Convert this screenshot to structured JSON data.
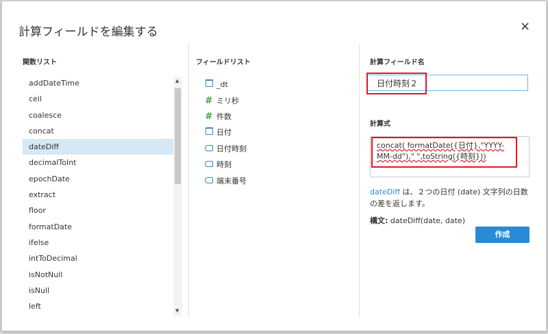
{
  "dialog": {
    "title": "計算フィールドを編集する",
    "close": "×"
  },
  "functions": {
    "header": "関数リスト",
    "items": [
      "addDateTime",
      "ceil",
      "coalesce",
      "concat",
      "dateDiff",
      "decimalToInt",
      "epochDate",
      "extract",
      "floor",
      "formatDate",
      "ifelse",
      "intToDecimal",
      "isNotNull",
      "isNull",
      "left"
    ],
    "selected": "dateDiff"
  },
  "fields": {
    "header": "フィールドリスト",
    "items": [
      {
        "label": "_dt",
        "icon": "calendar-icon"
      },
      {
        "label": "ミリ秒",
        "icon": "hash-icon"
      },
      {
        "label": "件数",
        "icon": "hash-icon"
      },
      {
        "label": "日付",
        "icon": "calendar-icon"
      },
      {
        "label": "日付時刻",
        "icon": "tag-icon"
      },
      {
        "label": "時刻",
        "icon": "tag-icon"
      },
      {
        "label": "端末番号",
        "icon": "tag-icon"
      }
    ]
  },
  "calc": {
    "name_label": "計算フィールド名",
    "name_value": "日付時刻２",
    "formula_label": "計算式",
    "formula": "concat( formatDate({日付},\"YYYY-MM-dd\"),\" \",toString({時刻}))",
    "desc_fn": "dateDiff",
    "desc_text": " は、２つの日付 (date) 文字列の日数の差を返します。",
    "syntax_label": "構文:",
    "syntax_value": " dateDiff(date, date)",
    "create_button": "作成"
  },
  "colors": {
    "accent": "#2a8ad4",
    "highlight": "#e8141b",
    "selected_row": "#d6e8f5"
  }
}
